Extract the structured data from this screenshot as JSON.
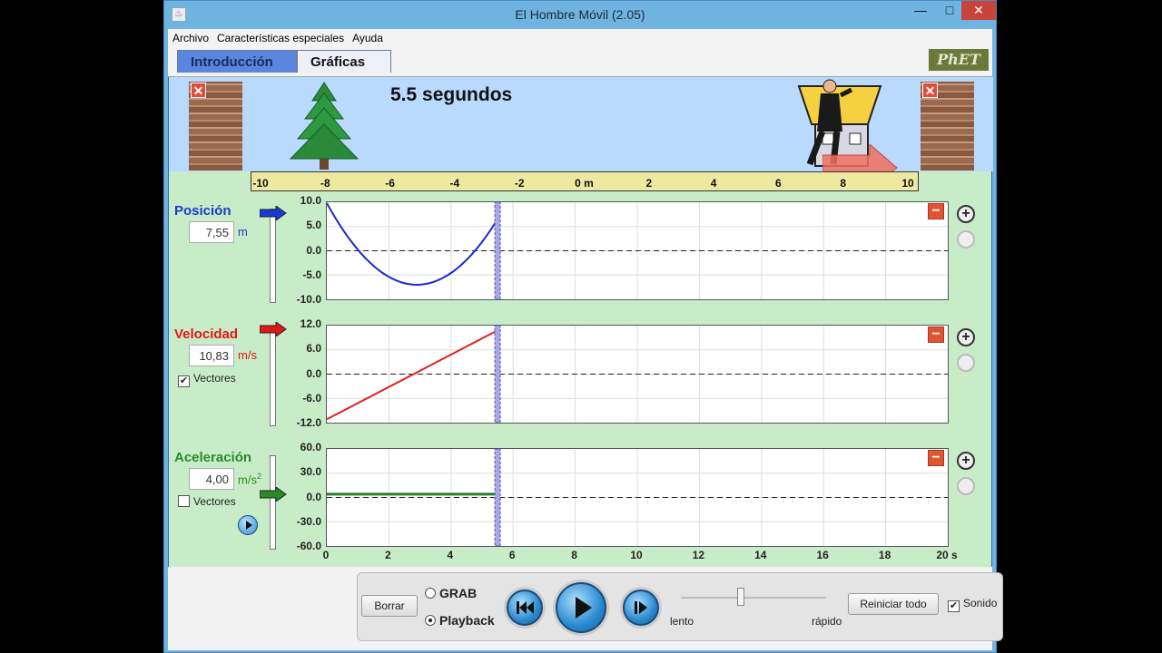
{
  "window": {
    "title": "El Hombre Móvil (2.05)"
  },
  "titlebar_buttons": {
    "minimize": "—",
    "maximize": "□",
    "close": "✕"
  },
  "menu": [
    "Archivo",
    "Características especiales",
    "Ayuda"
  ],
  "tabs": [
    {
      "label": "Introducción",
      "active": false
    },
    {
      "label": "Gráficas",
      "active": true
    }
  ],
  "logo": "PhET",
  "scene": {
    "time_text": "5.5 segundos",
    "ruler_ticks": [
      "-10",
      "-8",
      "-6",
      "-4",
      "-2",
      "0 m",
      "2",
      "4",
      "6",
      "8",
      "10"
    ],
    "wall_close": "✕"
  },
  "panels": {
    "position": {
      "label": "Posición",
      "value": "7,55",
      "unit": "m",
      "color": "#1a3ad0"
    },
    "velocity": {
      "label": "Velocidad",
      "value": "10,83",
      "unit": "m/s",
      "color": "#e01818",
      "vectors_label": "Vectores",
      "vectors_checked": "✔"
    },
    "acceleration": {
      "label": "Aceleración",
      "value": "4,00",
      "unit": "m/s",
      "unit_sup": "2",
      "color": "#2a8a2a",
      "vectors_label": "Vectores"
    }
  },
  "graph_buttons": {
    "minus": "−",
    "zoom_in": "+"
  },
  "time_axis": {
    "ticks": [
      "0",
      "2",
      "4",
      "6",
      "8",
      "10",
      "12",
      "14",
      "16",
      "18",
      "20 s"
    ]
  },
  "chart_data": [
    {
      "type": "line",
      "ylim": [
        -10,
        10
      ],
      "yticks": [
        "10.0",
        "5.0",
        "0.0",
        "-5.0",
        "-10.0"
      ],
      "xlim": [
        0,
        20
      ],
      "cursor_x": 5.5,
      "series": [
        {
          "color": "#1a2ad0",
          "x": [
            0,
            0.5,
            1,
            1.5,
            2,
            2.5,
            2.9,
            3.5,
            4,
            4.5,
            5,
            5.5
          ],
          "y": [
            7.7,
            3.0,
            -0.5,
            -3.4,
            -5.6,
            -6.8,
            -7.0,
            -6.6,
            -5.0,
            -2.6,
            0.9,
            7.55
          ]
        }
      ]
    },
    {
      "type": "line",
      "ylim": [
        -12,
        12
      ],
      "yticks": [
        "12.0",
        "6.0",
        "0.0",
        "-6.0",
        "-12.0"
      ],
      "xlim": [
        0,
        20
      ],
      "cursor_x": 5.5,
      "series": [
        {
          "color": "#e02020",
          "x": [
            0,
            5.5
          ],
          "y": [
            -11.17,
            10.83
          ]
        }
      ]
    },
    {
      "type": "line",
      "ylim": [
        -60,
        60
      ],
      "yticks": [
        "60.0",
        "30.0",
        "0.0",
        "-30.0",
        "-60.0"
      ],
      "xlim": [
        0,
        20
      ],
      "cursor_x": 5.5,
      "series": [
        {
          "color": "#2a7a2a",
          "x": [
            0,
            5.5
          ],
          "y": [
            4,
            4
          ]
        }
      ]
    }
  ],
  "controls": {
    "clear": "Borrar",
    "record": "GRAB",
    "playback": "Playback",
    "slow": "lento",
    "fast": "rápido",
    "reset_all": "Reiniciar todo",
    "sound": "Sonido",
    "sound_checked": "✔"
  }
}
